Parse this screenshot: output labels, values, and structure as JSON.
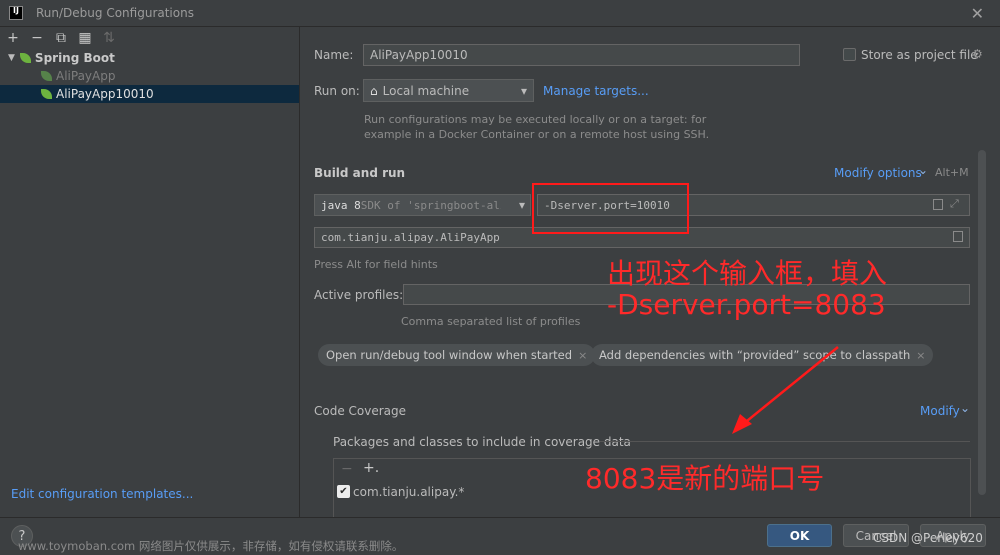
{
  "window": {
    "title": "Run/Debug Configurations",
    "close_glyph": "✕"
  },
  "toolbar": {
    "add": "+",
    "remove": "−",
    "copy": "⧉",
    "folder": "▦",
    "sort": "⇅"
  },
  "tree": {
    "root": {
      "label": "Spring Boot",
      "arrow": "▼"
    },
    "items": [
      {
        "label": "AliPayApp"
      },
      {
        "label": "AliPayApp10010"
      }
    ]
  },
  "edit_templates_label": "Edit configuration templates...",
  "config": {
    "name_label": "Name:",
    "name_value": "AliPayApp10010",
    "store_label": "Store as project file",
    "store_icon": "⚙",
    "run_on_label": "Run on:",
    "run_on_value": "Local machine",
    "run_on_icon": "⌂",
    "dropdown_glyph": "▾",
    "manage_targets": "Manage targets...",
    "run_on_hint_1": "Run configurations may be executed locally or on a target: for",
    "run_on_hint_2": "example in a Docker Container or on a remote host using SSH."
  },
  "build_run": {
    "title": "Build and run",
    "modify_options": "Modify options",
    "modify_arrow": "⌄",
    "shortcut": "Alt+M",
    "jdk_bold": "java 8",
    "jdk_rest": " SDK of 'springboot-ali",
    "vm_options": "-Dserver.port=10010",
    "expand_glyph": "⤢",
    "main_class": "com.tianju.alipay.AliPayApp",
    "field_hints": "Press Alt for field hints",
    "active_profiles_label": "Active profiles:",
    "active_profiles_value": "",
    "profiles_hint": "Comma separated list of profiles"
  },
  "chips": [
    {
      "label": "Open run/debug tool window when started",
      "x": "×"
    },
    {
      "label": "Add dependencies with “provided” scope to classpath",
      "x": "×"
    }
  ],
  "coverage": {
    "title": "Code Coverage",
    "modify": "Modify",
    "modify_arrow": "⌄",
    "packages_label": "Packages and classes to include in coverage data",
    "pkg_toolbar_minus": "−",
    "pkg_toolbar_plus": "+.",
    "package_item": "com.tianju.alipay.*",
    "check_glyph": "✔"
  },
  "annotations": {
    "line1": "出现这个输入框，填入",
    "line2": "-Dserver.port=8083",
    "line3": "8083是新的端口号",
    "color": "#ff1a1a"
  },
  "buttons": {
    "help": "?",
    "ok": "OK",
    "cancel": "Cancel",
    "apply": "Apply"
  },
  "watermarks": {
    "left": "www.toymoban.com 网络图片仅供展示，非存储，如有侵权请联系删除。",
    "right": "CSDN @Perley620"
  }
}
